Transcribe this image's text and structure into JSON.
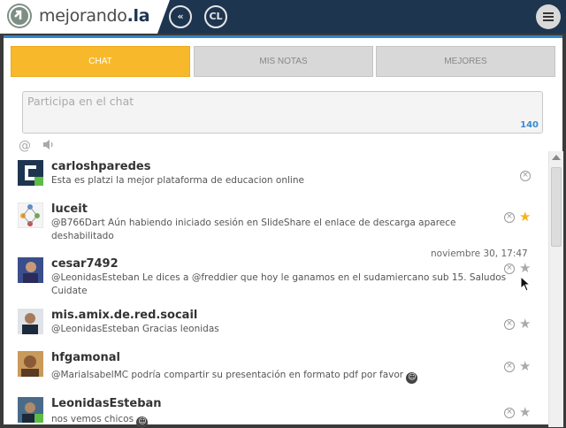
{
  "brand": {
    "name_prefix": "mejorando",
    "name_suffix": ".la"
  },
  "topbar": {
    "icon_back": "«",
    "icon_cl": "CL"
  },
  "tabs": [
    {
      "label": "CHAT",
      "active": true
    },
    {
      "label": "MIS NOTAS",
      "active": false
    },
    {
      "label": "MEJORES",
      "active": false
    }
  ],
  "chat": {
    "placeholder": "Participa en el chat",
    "counter": "140"
  },
  "colors": {
    "accent": "#f7b92b",
    "topbar": "#1e3550",
    "link": "#2f86c8"
  },
  "messages": [
    {
      "user": "carloshparedes",
      "text": "Esta es platzi la mejor plataforma de educacion online",
      "favorited": false,
      "timestamp": ""
    },
    {
      "user": "luceit",
      "text": "@B766Dart Aún habiendo iniciado sesión en SlideShare el enlace de descarga aparece deshabilitado",
      "favorited": true,
      "timestamp": ""
    },
    {
      "user": "cesar7492",
      "text": "@LeonidasEsteban Le dices a @freddier que hoy le ganamos en el sudamiercano sub 15. Saludos Cuidate",
      "favorited": false,
      "timestamp": "noviembre 30, 17:47"
    },
    {
      "user": "mis.amix.de.red.socail",
      "text": "@LeonidasEsteban Gracias leonidas",
      "favorited": false,
      "timestamp": ""
    },
    {
      "user": "hfgamonal",
      "text": "@MariaIsabelMC podría compartir su presentación en formato pdf por favor",
      "favorited": false,
      "timestamp": ""
    },
    {
      "user": "LeonidasEsteban",
      "text": "nos vemos chicos",
      "favorited": false,
      "timestamp": ""
    }
  ]
}
